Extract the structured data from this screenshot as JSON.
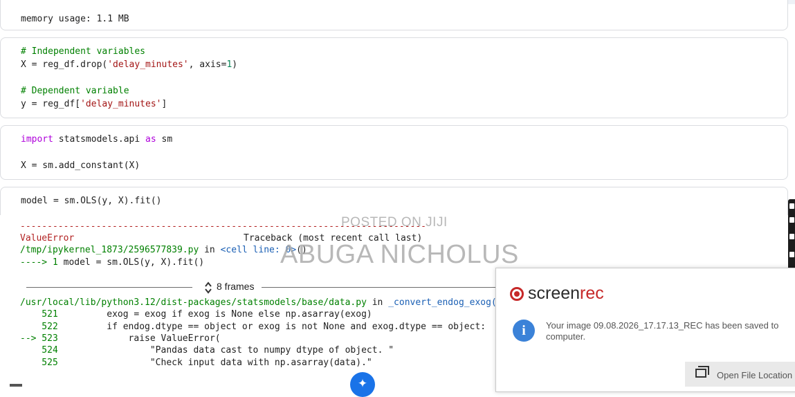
{
  "cells": {
    "info_output": {
      "text": "memory usage: 1.1 MB"
    },
    "variables": {
      "comment1": "# Independent variables",
      "line1_a": "X = reg_df.drop(",
      "line1_str": "'delay_minutes'",
      "line1_b": ", axis=",
      "line1_num": "1",
      "line1_c": ")",
      "comment2": "# Dependent variable",
      "line2_a": "y = reg_df[",
      "line2_str": "'delay_minutes'",
      "line2_b": "]"
    },
    "imports": {
      "kw_import": "import",
      "mod": " statsmodels.api ",
      "kw_as": "as",
      "alias": " sm",
      "line2": "X = sm.add_constant(X)"
    },
    "model": {
      "code": "model = sm.OLS(y, X).fit()"
    }
  },
  "traceback": {
    "dashes": "---------------------------------------------------------------------------",
    "error_type": "ValueError",
    "header_right": "Traceback (most recent call last)",
    "file1": "/tmp/ipykernel_1873/2596577839.py",
    "in_word": " in ",
    "cell_link": "<cell line: 0>",
    "cell_suffix": "()",
    "arrow_line_a": "----> 1 ",
    "arrow_line_b": "model = sm.OLS(y, X).fit()",
    "frames_label": "8 frames",
    "file2": "/usr/local/lib/python3.12/dist-packages/statsmodels/base/data.py",
    "in_word2": " in ",
    "func2": "_convert_endog_exog(se",
    "lines": [
      {
        "num": "    521",
        "code": "         exog = exog if exog is None else np.asarray(exog)"
      },
      {
        "num": "    522",
        "code": "         if endog.dtype == object or exog is not None and exog.dtype == object:"
      },
      {
        "num": "--> 523",
        "code": "             raise ValueError("
      },
      {
        "num": "    524",
        "code": "                 \"Pandas data cast to numpy dtype of object. \""
      },
      {
        "num": "    525",
        "code": "                 \"Check input data with np.asarray(data).\""
      }
    ]
  },
  "watermark": {
    "line1": "POSTED ON JIJI",
    "line2": "ABUGA NICHOLUS"
  },
  "notification": {
    "brand_a": "screen",
    "brand_b": "rec",
    "brand_a_color": "#2b2b2b",
    "brand_b_color": "#c62828",
    "icon": "info-icon",
    "message": "Your image 09.08.2026_17.17.13_REC has been saved to computer.",
    "button_label": "Open File Location"
  },
  "colors": {
    "comment": "#008000",
    "string": "#a31515",
    "keyword": "#af00db",
    "error": "#b22222",
    "link": "#1a5fb4",
    "accent": "#1a73e8"
  }
}
